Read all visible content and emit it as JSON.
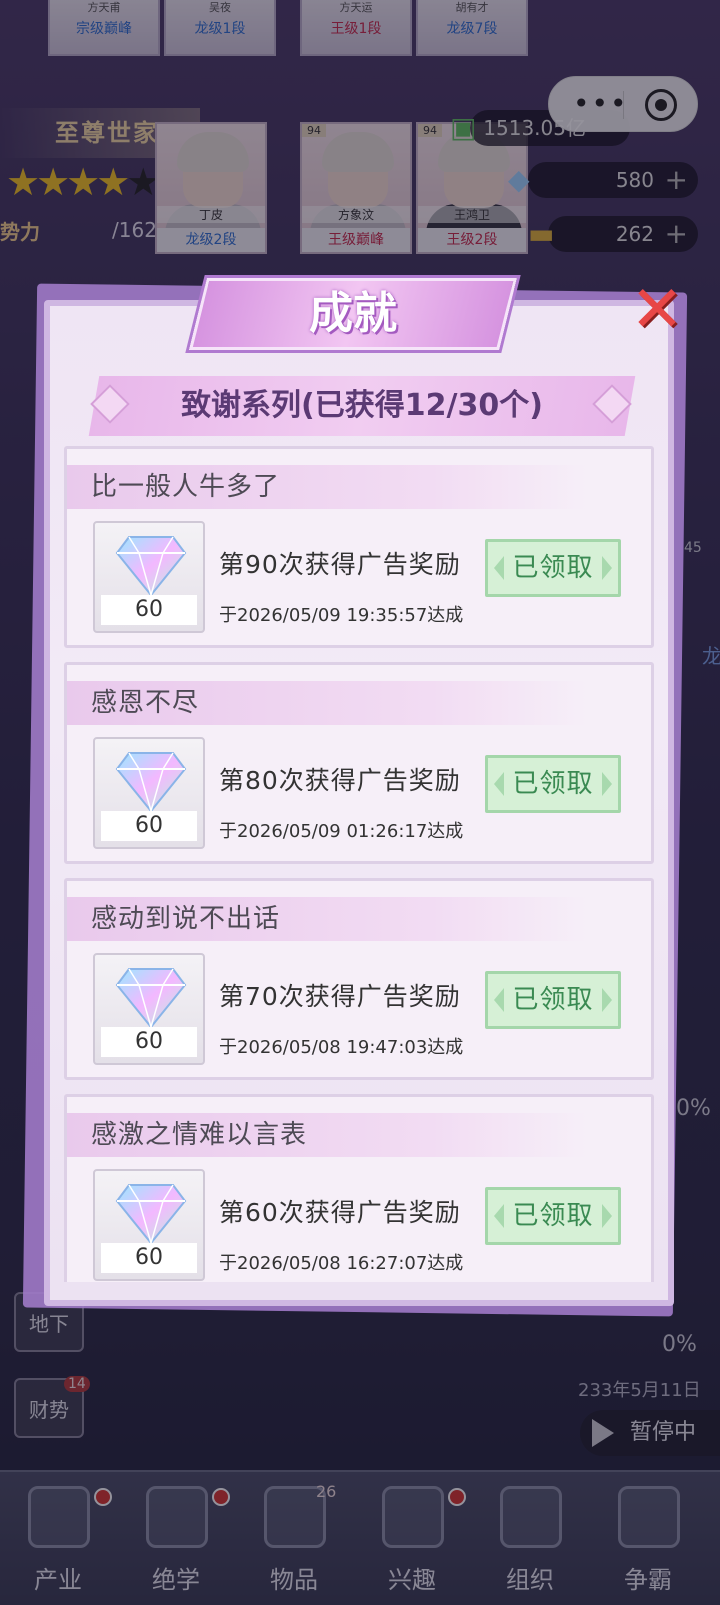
{
  "background": {
    "top_cards": [
      {
        "name": "方天甫",
        "level": "宗级巅峰",
        "color": "blue"
      },
      {
        "name": "吴夜",
        "level": "龙级1段",
        "color": "blue"
      },
      {
        "name": "方天运",
        "level": "王级1段",
        "color": "red"
      },
      {
        "name": "胡有才",
        "level": "龙级7段",
        "color": "blue"
      }
    ],
    "family_title": "至尊世家",
    "power_label": "势力",
    "power_value": "/16250",
    "characters": [
      {
        "badge": "",
        "name": "丁皮",
        "level": "龙级2段",
        "color": "blue"
      },
      {
        "badge": "94",
        "name": "方象汶",
        "level": "王级巅峰",
        "color": "red"
      },
      {
        "badge": "94",
        "name": "王鸿卫",
        "level": "王级2段",
        "color": "red"
      }
    ],
    "resources": {
      "money": "1513.05亿",
      "diamonds": "580",
      "gold": "262"
    },
    "side_buttons": [
      {
        "label": "地下"
      },
      {
        "label": "财势",
        "badge": "14"
      }
    ],
    "percent_top": "0%",
    "percent_bottom": "0%",
    "game_date": "233年5月11日",
    "pause_label": "暂停中",
    "right_card_badge": "45",
    "right_card_level": "龙"
  },
  "nav": [
    {
      "label": "产业",
      "dot": true
    },
    {
      "label": "绝学",
      "dot": true
    },
    {
      "label": "物品",
      "count": "26"
    },
    {
      "label": "兴趣",
      "dot": true
    },
    {
      "label": "组织"
    },
    {
      "label": "争霸"
    }
  ],
  "modal": {
    "title": "成就",
    "series_title": "致谢系列(已获得12/30个)",
    "achievements": [
      {
        "name": "比一般人牛多了",
        "reward_qty": "60",
        "desc": "第90次获得广告奖励",
        "date": "于2026/05/09 19:35:57达成",
        "button": "已领取"
      },
      {
        "name": "感恩不尽",
        "reward_qty": "60",
        "desc": "第80次获得广告奖励",
        "date": "于2026/05/09 01:26:17达成",
        "button": "已领取"
      },
      {
        "name": "感动到说不出话",
        "reward_qty": "60",
        "desc": "第70次获得广告奖励",
        "date": "于2026/05/08 19:47:03达成",
        "button": "已领取"
      },
      {
        "name": "感激之情难以言表",
        "reward_qty": "60",
        "desc": "第60次获得广告奖励",
        "date": "于2026/05/08 16:27:07达成",
        "button": "已领取"
      }
    ]
  },
  "colors": {
    "accent_pink": "#e8b7ea",
    "claimed_green": "#3a8a52",
    "close_red": "#e84646"
  }
}
